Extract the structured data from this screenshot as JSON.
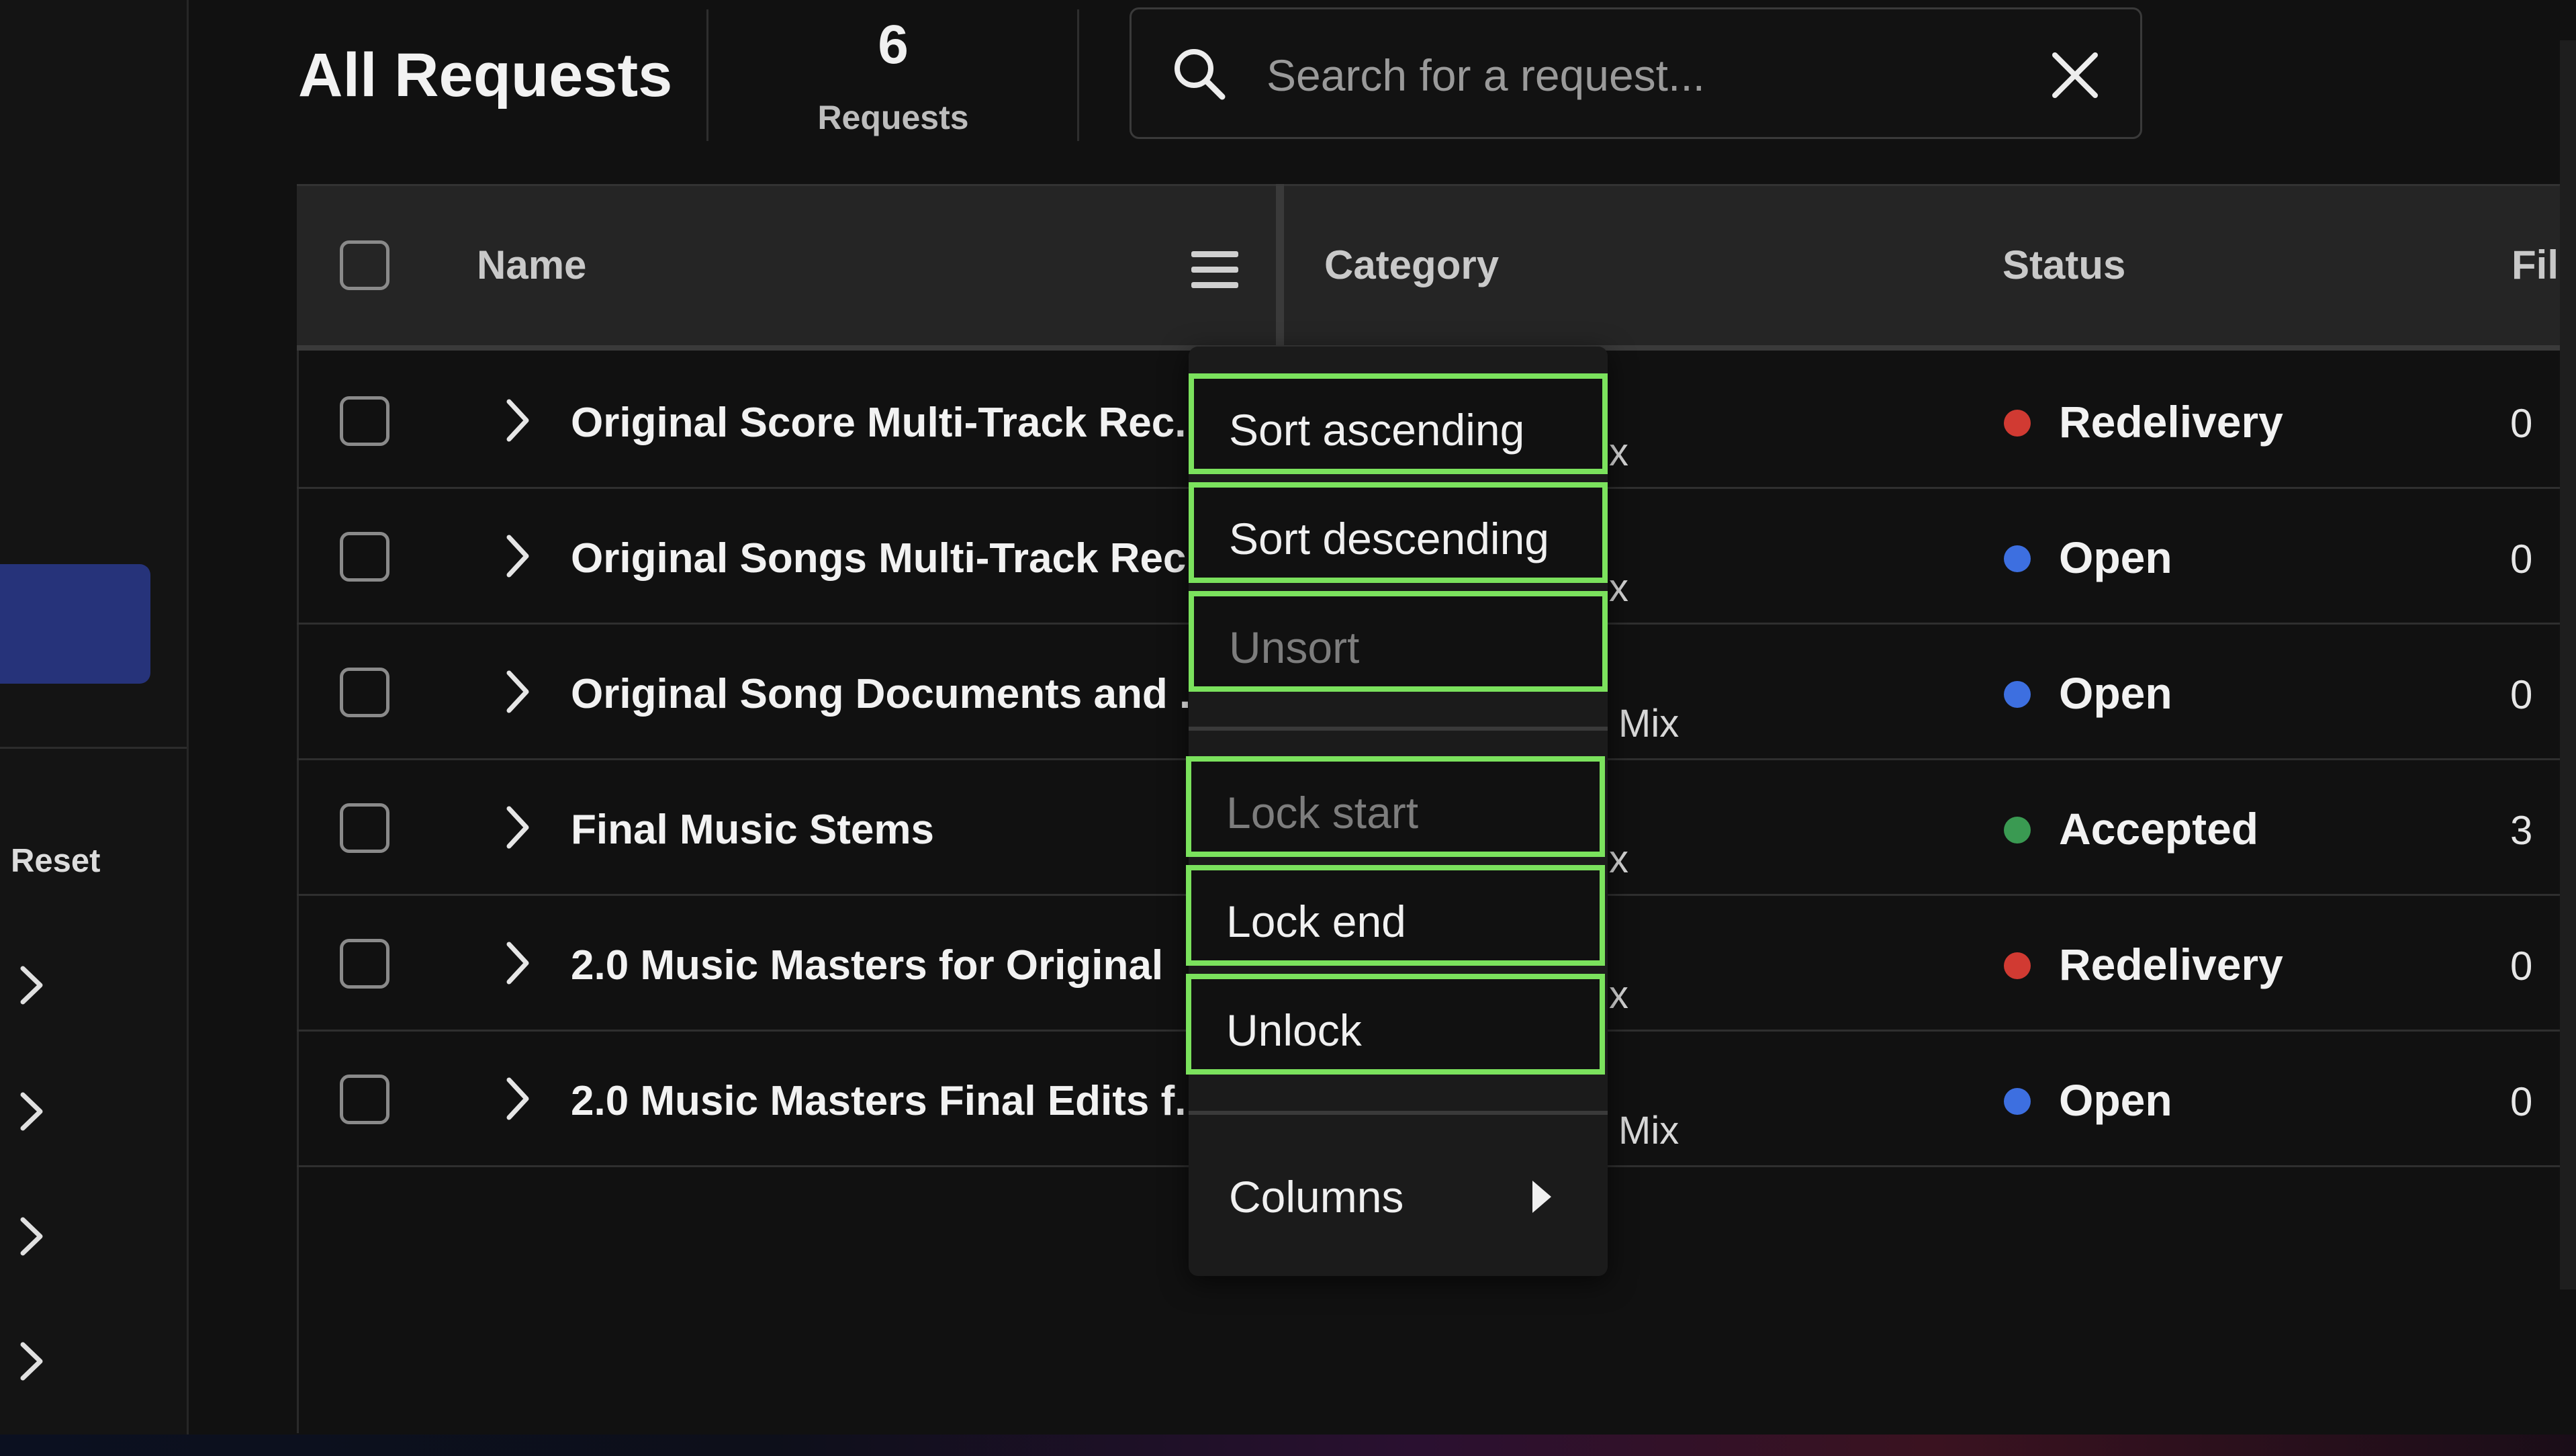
{
  "header": {
    "title": "All Requests",
    "count": "6",
    "count_label": "Requests",
    "search_placeholder": "Search for a request..."
  },
  "sidebar": {
    "reset_label": "Reset"
  },
  "table": {
    "columns": {
      "name": "Name",
      "category": "Category",
      "status": "Status",
      "files": "Fil"
    },
    "rows": [
      {
        "name": "Original Score Multi-Track Rec...",
        "category_fragment": "x",
        "status": "Redelivery",
        "status_color": "#d13a32",
        "files": "0"
      },
      {
        "name": "Original Songs Multi-Track Rec",
        "category_fragment": "x",
        "status": "Open",
        "status_color": "#3d6fe0",
        "files": "0"
      },
      {
        "name": "Original Song Documents and ...",
        "category_fragment": "Mix",
        "status": "Open",
        "status_color": "#3d6fe0",
        "files": "0"
      },
      {
        "name": "Final Music Stems",
        "category_fragment": "x",
        "status": "Accepted",
        "status_color": "#3a9a52",
        "files": "3"
      },
      {
        "name": "2.0 Music Masters for Original",
        "category_fragment": "x",
        "status": "Redelivery",
        "status_color": "#d13a32",
        "files": "0"
      },
      {
        "name": "2.0 Music Masters Final Edits f...",
        "category_fragment": "Mix",
        "status": "Open",
        "status_color": "#3d6fe0",
        "files": "0"
      }
    ]
  },
  "context_menu": {
    "sort_ascending": "Sort ascending",
    "sort_descending": "Sort descending",
    "unsort": "Unsort",
    "lock_start": "Lock start",
    "lock_end": "Lock end",
    "unlock": "Unlock",
    "columns": "Columns"
  },
  "colors": {
    "highlight": "#7be25d",
    "sidebar_active": "#26337a"
  }
}
